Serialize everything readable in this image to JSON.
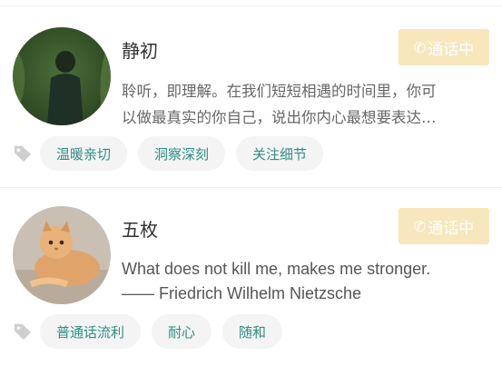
{
  "counselors": [
    {
      "name": "静初",
      "call_label": "通话中",
      "bio_line1": "聆听，即理解。在我们短短相遇的时间里，你可",
      "bio_line2": "以做最真实的你自己，说出你内心最想要表达…",
      "tags": [
        "温暖亲切",
        "洞察深刻",
        "关注细节"
      ],
      "avatar": "person-in-grass-photo"
    },
    {
      "name": "五枚",
      "call_label": "通话中",
      "bio_line1": "What does not kill me, makes me stronger.",
      "bio_line2": "—— Friedrich Wilhelm Nietzsche",
      "tags": [
        "普通话流利",
        "耐心",
        "随和"
      ],
      "avatar": "cat-photo"
    }
  ],
  "colors": {
    "call_button_bg": "#f8e7bd",
    "tag_text": "#2d8f83",
    "tag_bg": "#f4f4f4"
  }
}
